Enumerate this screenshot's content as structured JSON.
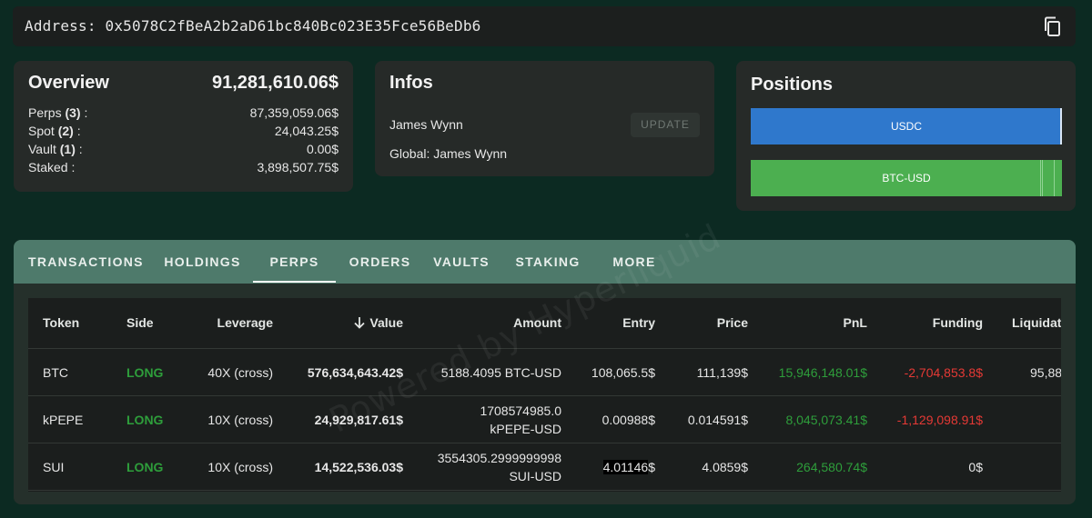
{
  "address": {
    "label": "Address:",
    "value": "0x5078C2fBeA2b2aD61bc840Bc023E35Fce56BeDb6"
  },
  "overview": {
    "title": "Overview",
    "total": "91,281,610.06$",
    "rows": [
      {
        "label": "Perps",
        "count": "(3)",
        "suffix": " :",
        "value": "87,359,059.06$"
      },
      {
        "label": "Spot",
        "count": "(2)",
        "suffix": " :",
        "value": "24,043.25$"
      },
      {
        "label": "Vault",
        "count": "(1)",
        "suffix": " :",
        "value": "0.00$"
      },
      {
        "label": "Staked",
        "count": "",
        "suffix": " :",
        "value": "3,898,507.75$"
      }
    ]
  },
  "infos": {
    "title": "Infos",
    "name": "James Wynn",
    "global": "Global: James Wynn",
    "update_label": "UPDATE"
  },
  "positions": {
    "title": "Positions",
    "bars": [
      {
        "label": "USDC",
        "color": "#2f78cc"
      },
      {
        "label": "BTC-USD",
        "color": "#4caf50"
      }
    ]
  },
  "tabs": [
    "TRANSACTIONS",
    "HOLDINGS",
    "PERPS",
    "ORDERS",
    "VAULTS",
    "STAKING",
    "MORE"
  ],
  "active_tab": "PERPS",
  "table": {
    "headers": {
      "token": "Token",
      "side": "Side",
      "leverage": "Leverage",
      "value": "Value",
      "amount": "Amount",
      "entry": "Entry",
      "price": "Price",
      "pnl": "PnL",
      "funding": "Funding",
      "liquidation": "Liquidati"
    },
    "rows": [
      {
        "token": "BTC",
        "side": "LONG",
        "leverage": "40X (cross)",
        "value": "576,634,643.42$",
        "amount_line1": "5188.4095 BTC-USD",
        "amount_line2": "",
        "entry": "108,065.5$",
        "price": "111,139$",
        "pnl": "15,946,148.01$",
        "funding": "-2,704,853.8$",
        "liquidation": "95,88"
      },
      {
        "token": "kPEPE",
        "side": "LONG",
        "leverage": "10X (cross)",
        "value": "24,929,817.61$",
        "amount_line1": "1708574985.0",
        "amount_line2": "kPEPE-USD",
        "entry": "0.00988$",
        "price": "0.014591$",
        "pnl": "8,045,073.41$",
        "funding": "-1,129,098.91$",
        "liquidation": ""
      },
      {
        "token": "SUI",
        "side": "LONG",
        "leverage": "10X (cross)",
        "value": "14,522,536.03$",
        "amount_line1": "3554305.2999999998",
        "amount_line2": "SUI-USD",
        "entry_hl": "4.01146",
        "entry_rest": "$",
        "price": "4.0859$",
        "pnl": "264,580.74$",
        "funding": "0$",
        "liquidation": ""
      }
    ]
  },
  "watermark": "Powered by Hyperliquid"
}
